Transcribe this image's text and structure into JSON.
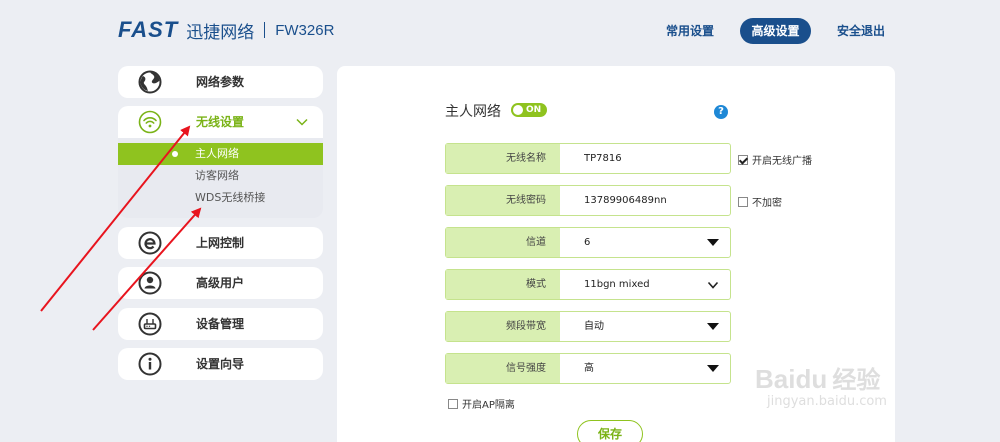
{
  "header": {
    "logo": "FAST",
    "brand_cn": "迅捷网络",
    "model": "FW326R",
    "nav": [
      {
        "label": "常用设置"
      },
      {
        "label": "高级设置",
        "active": true
      },
      {
        "label": "安全退出"
      }
    ]
  },
  "sidebar": {
    "items": [
      {
        "label": "网络参数",
        "icon": "globe-icon"
      },
      {
        "label": "无线设置",
        "icon": "wifi-icon",
        "expanded": true
      },
      {
        "label": "上网控制",
        "icon": "internet-explorer-icon"
      },
      {
        "label": "高级用户",
        "icon": "user-icon"
      },
      {
        "label": "设备管理",
        "icon": "router-icon"
      },
      {
        "label": "设置向导",
        "icon": "info-icon"
      }
    ],
    "wireless_sub": [
      {
        "label": "主人网络",
        "active": true
      },
      {
        "label": "访客网络"
      },
      {
        "label": "WDS无线桥接"
      }
    ]
  },
  "main": {
    "title": "主人网络",
    "toggle": "ON",
    "help": "?",
    "fields": [
      {
        "label": "无线名称",
        "value": "TP7816"
      },
      {
        "label": "无线密码",
        "value": "13789906489nn"
      },
      {
        "label": "信道",
        "value": "6"
      },
      {
        "label": "模式",
        "value": "11bgn mixed"
      },
      {
        "label": "频段带宽",
        "value": "自动"
      },
      {
        "label": "信号强度",
        "value": "高"
      }
    ],
    "broadcast_label": "开启无线广播",
    "broadcast_checked": true,
    "no_encrypt_label": "不加密",
    "no_encrypt_checked": false,
    "ap_isolation_label": "开启AP隔离",
    "ap_isolation_checked": false,
    "save_label": "保存"
  },
  "watermark": {
    "main": "Bai",
    "paw": "du",
    "cn": "经验",
    "sub": "jingyan.baidu.com"
  },
  "colors": {
    "brand_blue": "#1a4f8c",
    "accent_green": "#8fc31f",
    "label_green": "#d9efb2",
    "arrow_red": "#e8141e"
  }
}
